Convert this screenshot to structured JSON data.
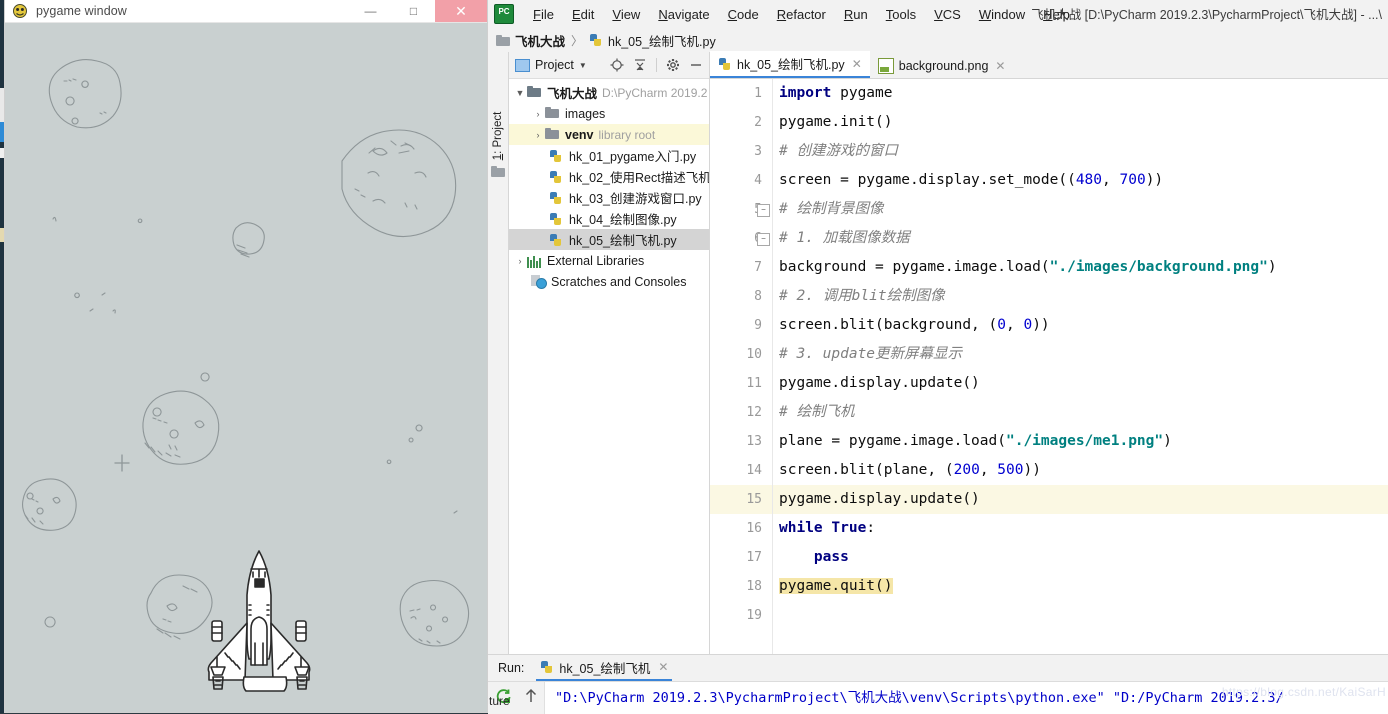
{
  "pygame_window": {
    "title": "pygame window",
    "icon": "pygame-icon",
    "minimize_label": "—",
    "maximize_label": "□",
    "close_label": "✕",
    "canvas_bg": "#c9d0d0"
  },
  "ide": {
    "window_title": "飞机大战 [D:\\PyCharm 2019.2.3\\PycharmProject\\飞机大战] - ...\\",
    "logo_text": "PC",
    "menu": [
      {
        "label": "File",
        "mnemonic": "F"
      },
      {
        "label": "Edit",
        "mnemonic": "E"
      },
      {
        "label": "View",
        "mnemonic": "V"
      },
      {
        "label": "Navigate",
        "mnemonic": "N"
      },
      {
        "label": "Code",
        "mnemonic": "C"
      },
      {
        "label": "Refactor",
        "mnemonic": "R"
      },
      {
        "label": "Run",
        "mnemonic": "R"
      },
      {
        "label": "Tools",
        "mnemonic": "T"
      },
      {
        "label": "VCS",
        "mnemonic": "V"
      },
      {
        "label": "Window",
        "mnemonic": "W"
      },
      {
        "label": "Help",
        "mnemonic": "H"
      }
    ],
    "breadcrumb": {
      "project": "飞机大战",
      "separator": "〉",
      "file": "hk_05_绘制飞机.py"
    },
    "tool_strip": {
      "label": "1: Project",
      "mnemonic": "1"
    },
    "project_panel": {
      "title": "Project",
      "caret": "▼",
      "tools": [
        "locate-icon",
        "collapse-all-icon",
        "settings-icon",
        "hide-icon"
      ],
      "tree": [
        {
          "label": "飞机大战",
          "hint": "D:\\PyCharm 2019.2",
          "icon": "folder-icon",
          "arrow": "▼",
          "indent": 1,
          "bold": true,
          "state": "normal"
        },
        {
          "label": "images",
          "hint": "",
          "icon": "folder-icon",
          "arrow": "›",
          "indent": 2,
          "bold": false,
          "state": "normal"
        },
        {
          "label": "venv",
          "hint": "library root",
          "icon": "folder-icon",
          "arrow": "›",
          "indent": 2,
          "bold": true,
          "state": "highlight"
        },
        {
          "label": "hk_01_pygame入门.py",
          "hint": "",
          "icon": "python-file-icon",
          "arrow": "",
          "indent": 3,
          "bold": false,
          "state": "normal"
        },
        {
          "label": "hk_02_使用Rect描述飞机.p",
          "hint": "",
          "icon": "python-file-icon",
          "arrow": "",
          "indent": 3,
          "bold": false,
          "state": "normal"
        },
        {
          "label": "hk_03_创建游戏窗口.py",
          "hint": "",
          "icon": "python-file-icon",
          "arrow": "",
          "indent": 3,
          "bold": false,
          "state": "normal"
        },
        {
          "label": "hk_04_绘制图像.py",
          "hint": "",
          "icon": "python-file-icon",
          "arrow": "",
          "indent": 3,
          "bold": false,
          "state": "normal"
        },
        {
          "label": "hk_05_绘制飞机.py",
          "hint": "",
          "icon": "python-file-icon",
          "arrow": "",
          "indent": 3,
          "bold": false,
          "state": "selected"
        },
        {
          "label": "External Libraries",
          "hint": "",
          "icon": "libraries-icon",
          "arrow": "›",
          "indent": 1,
          "bold": false,
          "state": "normal"
        },
        {
          "label": "Scratches and Consoles",
          "hint": "",
          "icon": "scratches-icon",
          "arrow": "",
          "indent": 1,
          "bold": false,
          "state": "normal"
        }
      ]
    },
    "editor_tabs": [
      {
        "label": "hk_05_绘制飞机.py",
        "icon": "python-file-icon",
        "close": "✕",
        "active": true
      },
      {
        "label": "background.png",
        "icon": "image-file-icon",
        "close": "✕",
        "active": false
      }
    ],
    "code": {
      "highlight_line": 15,
      "lines": [
        {
          "n": 1,
          "html": "<span class='kw'>import</span> pygame",
          "fold": ""
        },
        {
          "n": 2,
          "html": "pygame.init()",
          "fold": ""
        },
        {
          "n": 3,
          "html": "<span class='cmt'># 创建游戏的窗口</span>",
          "fold": ""
        },
        {
          "n": 4,
          "html": "screen = pygame.display.set_mode((<span class='num'>480</span>, <span class='num'>700</span>))",
          "fold": ""
        },
        {
          "n": 5,
          "html": "<span class='cmt'># 绘制背景图像</span>",
          "fold": "−"
        },
        {
          "n": 6,
          "html": "<span class='cmt'># 1. 加载图像数据</span>",
          "fold": "−"
        },
        {
          "n": 7,
          "html": "background = pygame.image.load(<span class='str'>\"./images/background.png\"</span>)",
          "fold": ""
        },
        {
          "n": 8,
          "html": "<span class='cmt'># 2. 调用blit绘制图像</span>",
          "fold": ""
        },
        {
          "n": 9,
          "html": "screen.blit(background, (<span class='num'>0</span>, <span class='num'>0</span>))",
          "fold": ""
        },
        {
          "n": 10,
          "html": "<span class='cmt'># 3. update更新屏幕显示</span>",
          "fold": ""
        },
        {
          "n": 11,
          "html": "pygame.display.update()",
          "fold": ""
        },
        {
          "n": 12,
          "html": "<span class='cmt'># 绘制飞机</span>",
          "fold": ""
        },
        {
          "n": 13,
          "html": "plane = pygame.image.load(<span class='str'>\"./images/me1.png\"</span>)",
          "fold": ""
        },
        {
          "n": 14,
          "html": "screen.blit(plane, (<span class='num'>200</span>, <span class='num'>500</span>))",
          "fold": ""
        },
        {
          "n": 15,
          "html": "pygame.display.update()",
          "fold": ""
        },
        {
          "n": 16,
          "html": "<span class='kw'>while</span> <span class='kw'>True</span>:",
          "fold": ""
        },
        {
          "n": 17,
          "html": "    <span class='kw'>pass</span>",
          "fold": ""
        },
        {
          "n": 18,
          "html": "<span class='hlbox'>pygame.quit()</span>",
          "fold": ""
        },
        {
          "n": 19,
          "html": "",
          "fold": ""
        }
      ],
      "plain_lines": [
        "import pygame",
        "pygame.init()",
        "# 创建游戏的窗口",
        "screen = pygame.display.set_mode((480, 700))",
        "# 绘制背景图像",
        "# 1. 加载图像数据",
        "background = pygame.image.load(\"./images/background.png\")",
        "# 2. 调用blit绘制图像",
        "screen.blit(background, (0, 0))",
        "# 3. update更新屏幕显示",
        "pygame.display.update()",
        "# 绘制飞机",
        "plane = pygame.image.load(\"./images/me1.png\")",
        "screen.blit(plane, (200, 500))",
        "pygame.display.update()",
        "while True:",
        "    pass",
        "pygame.quit()",
        ""
      ]
    },
    "run_panel": {
      "label": "Run:",
      "tab_label": "hk_05_绘制飞机",
      "tab_close": "✕",
      "rerun_icon": "rerun-icon",
      "up_icon": "up-arrow-icon",
      "output": "\"D:\\PyCharm 2019.2.3\\PycharmProject\\飞机大战\\venv\\Scripts\\python.exe\" \"D:/PyCharm 2019.2.3/",
      "watermark": "https://blog.csdn.net/KaiSarH"
    },
    "status_fragment": "ture"
  },
  "colors": {
    "accent_blue": "#3a84d8",
    "highlight_line": "#fbf8e3",
    "selection_grey": "#d4d4d4",
    "venv_highlight": "#fbf8d8",
    "close_red": "#f2a0a8",
    "canvas": "#c9d0d0"
  }
}
